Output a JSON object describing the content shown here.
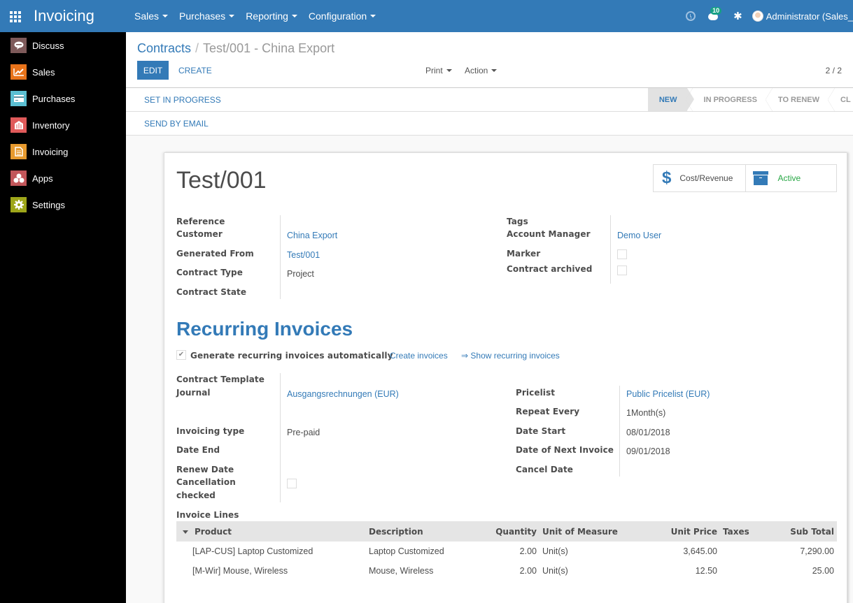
{
  "topbar": {
    "app_title": "Invoicing",
    "menus": [
      {
        "label": "Sales"
      },
      {
        "label": "Purchases"
      },
      {
        "label": "Reporting"
      },
      {
        "label": "Configuration"
      }
    ],
    "messages_badge": "10",
    "user_name": "Administrator (Sales_"
  },
  "sidebar": {
    "items": [
      {
        "label": "Discuss",
        "icon": "discuss-icon",
        "color": "#7e5a5a"
      },
      {
        "label": "Sales",
        "icon": "sales-chart-icon",
        "color": "#e8731a"
      },
      {
        "label": "Purchases",
        "icon": "purchases-card-icon",
        "color": "#5bbfd2"
      },
      {
        "label": "Inventory",
        "icon": "inventory-icon",
        "color": "#e05a5a"
      },
      {
        "label": "Invoicing",
        "icon": "invoicing-icon",
        "color": "#e79a2e"
      },
      {
        "label": "Apps",
        "icon": "apps-icon",
        "color": "#c2565a"
      },
      {
        "label": "Settings",
        "icon": "settings-gear-icon",
        "color": "#9ea61a"
      }
    ]
  },
  "control": {
    "breadcrumb_parent": "Contracts",
    "breadcrumb_sep": "/",
    "breadcrumb_current": "Test/001 - China Export",
    "edit_label": "EDIT",
    "create_label": "CREATE",
    "print_label": "Print",
    "action_label": "Action",
    "pager": "2 / 2",
    "set_in_progress_label": "SET IN PROGRESS",
    "send_by_email_label": "SEND BY EMAIL",
    "stages": [
      {
        "label": "NEW",
        "active": true
      },
      {
        "label": "IN PROGRESS",
        "active": false
      },
      {
        "label": "TO RENEW",
        "active": false
      },
      {
        "label": "CL",
        "active": false
      }
    ]
  },
  "record": {
    "title": "Test/001",
    "smart_buttons": {
      "cost_revenue": "Cost/Revenue",
      "active": "Active"
    },
    "left_fields": {
      "reference_label": "Reference",
      "customer_label": "Customer",
      "customer_value": "China Export",
      "generated_from_label": "Generated From",
      "generated_from_value": "Test/001",
      "contract_type_label": "Contract Type",
      "contract_type_value": "Project",
      "contract_state_label": "Contract State"
    },
    "right_fields": {
      "tags_label": "Tags",
      "account_manager_label": "Account Manager",
      "account_manager_value": "Demo User",
      "marker_label": "Marker",
      "marker_checked": false,
      "contract_archived_label": "Contract archived",
      "contract_archived_checked": false
    }
  },
  "recurring": {
    "section_title": "Recurring Invoices",
    "auto_generate_label": "Generate recurring invoices automatically",
    "auto_generate_checked": true,
    "create_invoices_link": "Create invoices",
    "show_recurring_link": "⇒ Show recurring invoices",
    "left_fields": {
      "contract_template_label": "Contract Template",
      "journal_label": "Journal",
      "journal_value": "Ausgangsrechnungen (EUR)",
      "invoicing_type_label": "Invoicing type",
      "invoicing_type_value": "Pre-paid",
      "date_end_label": "Date End",
      "renew_date_label": "Renew Date",
      "cancellation_label_1": "Cancellation",
      "cancellation_label_2": "checked",
      "cancellation_checked": false
    },
    "right_fields": {
      "pricelist_label": "Pricelist",
      "pricelist_value": "Public Pricelist (EUR)",
      "repeat_every_label": "Repeat Every",
      "repeat_every_value": "1Month(s)",
      "date_start_label": "Date Start",
      "date_start_value": "08/01/2018",
      "next_invoice_label": "Date of Next Invoice",
      "next_invoice_value": "09/01/2018",
      "cancel_date_label": "Cancel Date"
    }
  },
  "invoice_lines": {
    "label": "Invoice Lines",
    "columns": [
      "Product",
      "Description",
      "Quantity",
      "Unit of Measure",
      "Unit Price",
      "Taxes",
      "Sub Total"
    ],
    "rows": [
      {
        "product": "[LAP-CUS] Laptop Customized",
        "description": "Laptop Customized",
        "quantity": "2.00",
        "uom": "Unit(s)",
        "unit_price": "3,645.00",
        "taxes": "",
        "subtotal": "7,290.00"
      },
      {
        "product": "[M-Wir] Mouse, Wireless",
        "description": "Mouse, Wireless",
        "quantity": "2.00",
        "uom": "Unit(s)",
        "unit_price": "12.50",
        "taxes": "",
        "subtotal": "25.00"
      }
    ]
  }
}
